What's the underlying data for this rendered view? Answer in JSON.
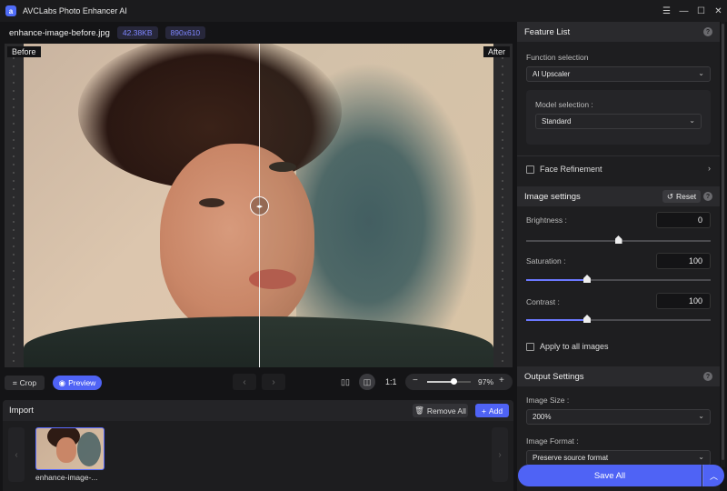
{
  "window": {
    "title": "AVCLabs Photo Enhancer AI",
    "logo_text": "a",
    "controls": [
      "☰",
      "—",
      "☐",
      "✕"
    ]
  },
  "file": {
    "name": "enhance-image-before.jpg",
    "size": "42.38KB",
    "dimensions": "890x610"
  },
  "viewer": {
    "before_label": "Before",
    "after_label": "After",
    "split_percent": 50
  },
  "toolbar": {
    "crop_label": "Crop",
    "preview_label": "Preview",
    "prev_icon": "chevron-left",
    "next_icon": "chevron-right",
    "ratio_label": "1:1",
    "zoom_value": "97%",
    "zoom_fraction": 0.6
  },
  "import": {
    "title": "Import",
    "remove_all_label": "Remove All",
    "add_label": "Add",
    "thumbnails": [
      {
        "label": "enhance-image-..."
      }
    ]
  },
  "feature_list": {
    "title": "Feature List",
    "function_label": "Function selection",
    "function_value": "AI Upscaler",
    "model_label": "Model selection :",
    "model_value": "Standard",
    "face_refinement_label": "Face Refinement"
  },
  "image_settings": {
    "title": "Image settings",
    "reset_label": "Reset",
    "brightness": {
      "label": "Brightness :",
      "value": "0",
      "fraction": 0.5
    },
    "saturation": {
      "label": "Saturation :",
      "value": "100",
      "fraction": 0.33
    },
    "contrast": {
      "label": "Contrast :",
      "value": "100",
      "fraction": 0.33
    },
    "apply_all_label": "Apply to all images"
  },
  "output_settings": {
    "title": "Output Settings",
    "image_size_label": "Image Size :",
    "image_size_value": "200%",
    "image_format_label": "Image Format :",
    "image_format_value": "Preserve source format"
  },
  "save": {
    "label": "Save All"
  },
  "colors": {
    "accent": "#4f63f5",
    "chip_text": "#7f86ff",
    "slider_fill": "#6b78ff"
  }
}
